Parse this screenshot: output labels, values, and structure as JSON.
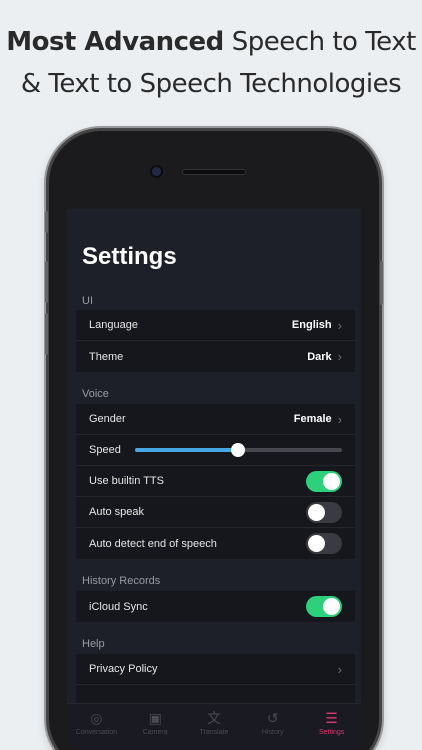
{
  "headline": {
    "bold": "Most Advanced",
    "rest": "Speech to Text",
    "line2": "& Text to Speech Technologies"
  },
  "screen": {
    "title": "Settings",
    "sections": {
      "ui": {
        "label": "UI",
        "language": {
          "label": "Language",
          "value": "English"
        },
        "theme": {
          "label": "Theme",
          "value": "Dark"
        }
      },
      "voice": {
        "label": "Voice",
        "gender": {
          "label": "Gender",
          "value": "Female"
        },
        "speed": {
          "label": "Speed",
          "level": 0.5
        },
        "builtin_tts": {
          "label": "Use builtin TTS",
          "on": true
        },
        "auto_speak": {
          "label": "Auto speak",
          "on": false
        },
        "auto_detect": {
          "label": "Auto detect end of speech",
          "on": false
        }
      },
      "history": {
        "label": "History Records",
        "icloud": {
          "label": "iCloud Sync",
          "on": true
        }
      },
      "help": {
        "label": "Help",
        "privacy": {
          "label": "Privacy Policy"
        }
      }
    },
    "tabs": [
      {
        "label": "Conversation",
        "icon": "conversation-icon"
      },
      {
        "label": "Camera",
        "icon": "camera-icon"
      },
      {
        "label": "Translate",
        "icon": "translate-icon"
      },
      {
        "label": "History",
        "icon": "history-icon"
      },
      {
        "label": "Settings",
        "icon": "settings-icon",
        "active": true
      }
    ],
    "colors": {
      "accent_toggle": "#2ed17b",
      "slider": "#4aa7e6",
      "active_tab": "#e0356f"
    }
  }
}
